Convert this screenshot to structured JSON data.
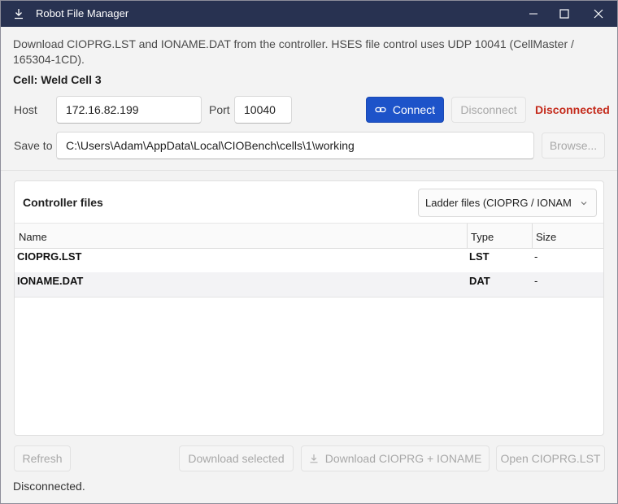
{
  "window": {
    "title": "Robot File Manager",
    "icon": "download-icon"
  },
  "description": "Download CIOPRG.LST and IONAME.DAT from the controller. HSES file control uses UDP 10041 (CellMaster / 165304-1CD).",
  "cell_label": "Cell: Weld Cell 3",
  "connection": {
    "host_label": "Host",
    "host_value": "172.16.82.199",
    "port_label": "Port",
    "port_value": "10040",
    "connect_label": "Connect",
    "disconnect_label": "Disconnect",
    "status": "Disconnected",
    "status_color": "#c42b1c"
  },
  "save": {
    "label": "Save to",
    "path": "C:\\Users\\Adam\\AppData\\Local\\CIOBench\\cells\\1\\working",
    "browse_label": "Browse..."
  },
  "files_panel": {
    "title": "Controller files",
    "filter_selected": "Ladder files (CIOPRG / IONAM",
    "columns": [
      "Name",
      "Type",
      "Size"
    ],
    "rows": [
      {
        "name": "CIOPRG.LST",
        "type": "LST",
        "size": "-"
      },
      {
        "name": "IONAME.DAT",
        "type": "DAT",
        "size": "-"
      }
    ]
  },
  "actions": {
    "refresh": "Refresh",
    "download_selected": "Download selected",
    "download_both": "Download CIOPRG + IONAME",
    "open": "Open CIOPRG.LST"
  },
  "status_line": "Disconnected.",
  "colors": {
    "titlebar": "#283251",
    "accent": "#1d53c9"
  }
}
